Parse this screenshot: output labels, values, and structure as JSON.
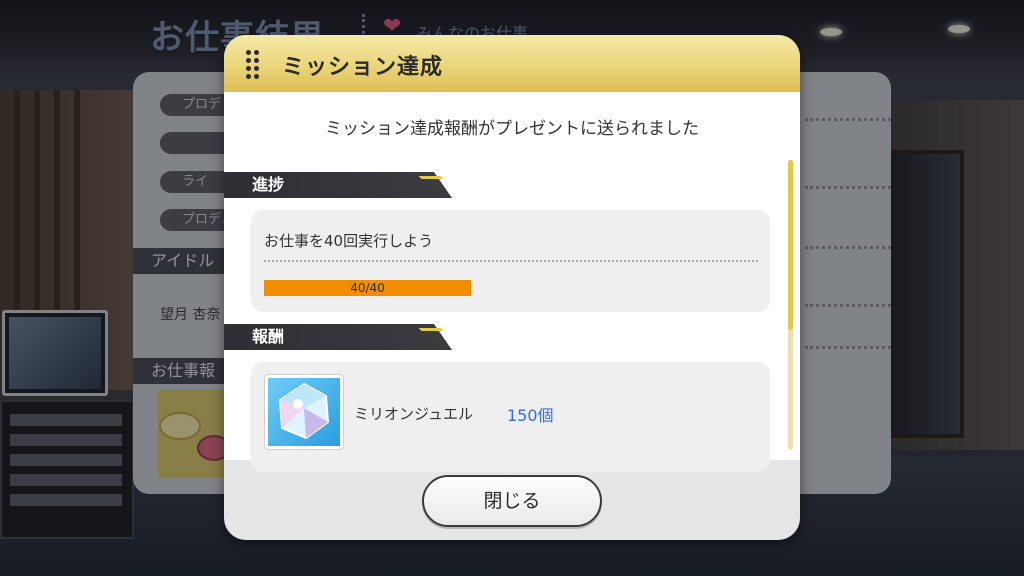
{
  "background": {
    "title": "お仕事結果",
    "tab_label": "みんなのお仕事",
    "panel_pills": [
      "プロデ",
      "",
      "ライ",
      "プロデュ"
    ],
    "idol_band": "アイドル",
    "idol_name": "望月 杏奈",
    "work_band": "お仕事報"
  },
  "dialog": {
    "title": "ミッション達成",
    "message": "ミッション達成報酬がプレゼントに送られました",
    "progress_section": "進捗",
    "mission_text": "お仕事を40回実行しよう",
    "progress_label": "40/40",
    "progress_fraction": 1.0,
    "reward_section": "報酬",
    "reward_name": "ミリオンジュエル",
    "reward_quantity": "150個",
    "reward_icon": "jewel-icon",
    "close_label": "閉じる"
  },
  "colors": {
    "header_gold": "#e6cf6e",
    "progress_orange": "#f28c00",
    "quantity_blue": "#2f6fe0"
  }
}
